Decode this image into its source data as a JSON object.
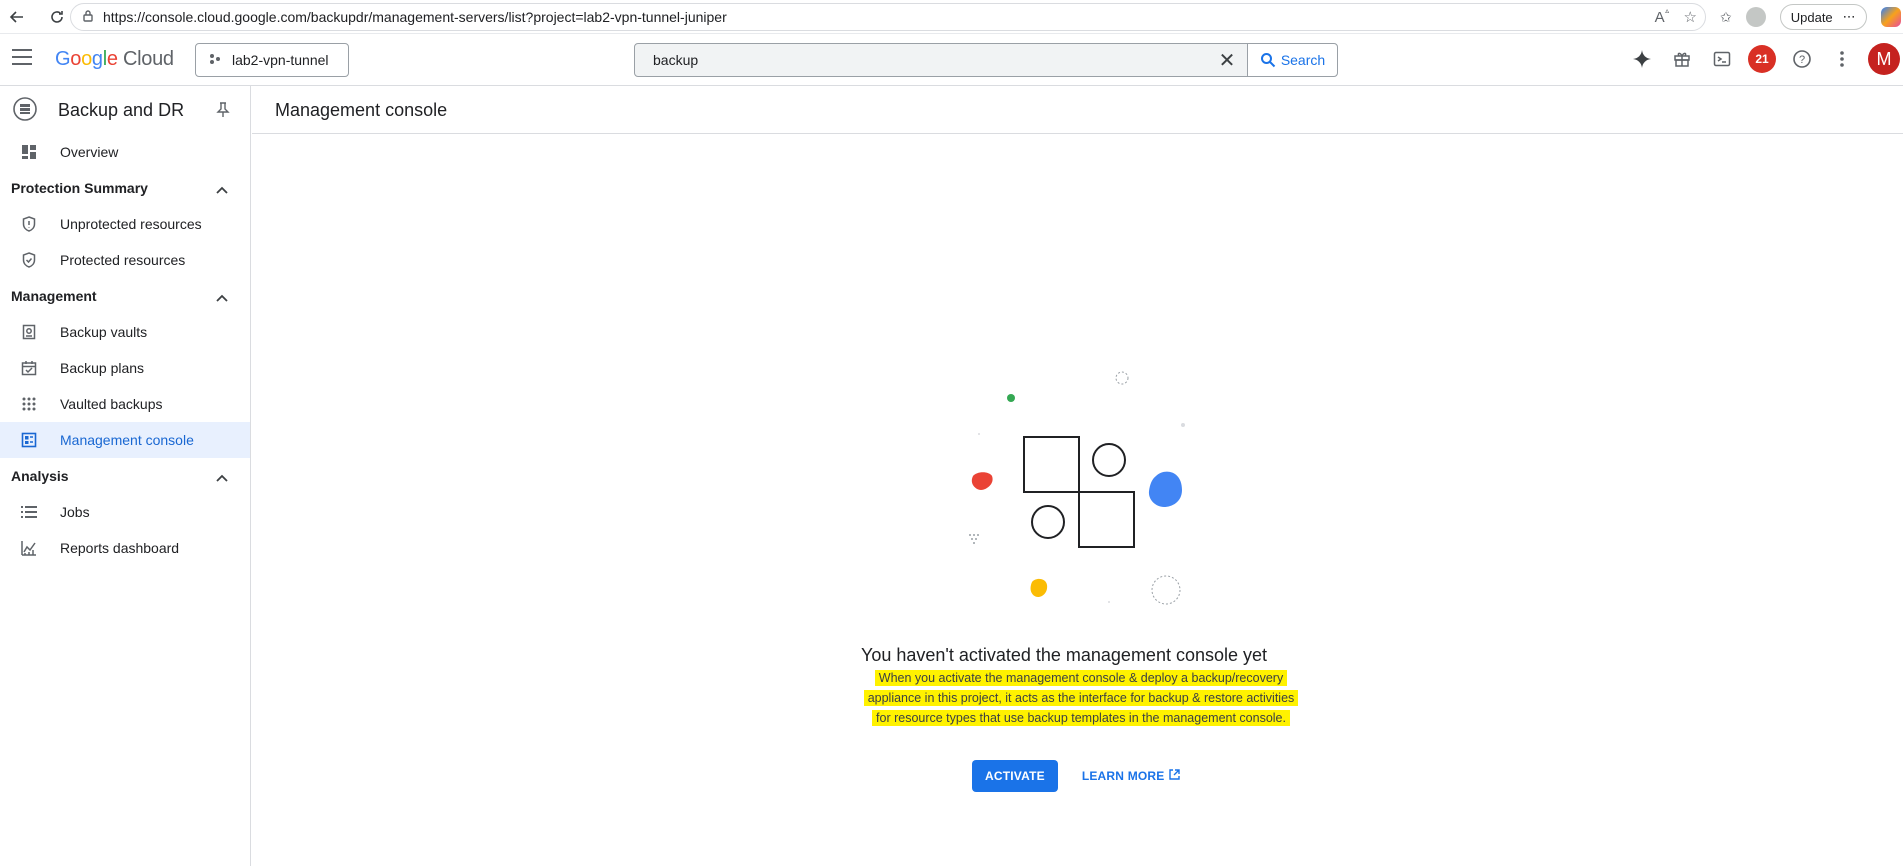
{
  "browser": {
    "url": "https://console.cloud.google.com/backupdr/management-servers/list?project=lab2-vpn-tunnel-juniper",
    "update_label": "Update"
  },
  "header": {
    "logo_google": "Google",
    "logo_cloud": "Cloud",
    "project": "lab2-vpn-tunnel",
    "search_value": "backup",
    "search_button": "Search",
    "notification_count": "21",
    "avatar_initial": "M"
  },
  "sidebar": {
    "title": "Backup and DR",
    "overview": "Overview",
    "sections": [
      {
        "label": "Protection Summary",
        "items": [
          "Unprotected resources",
          "Protected resources"
        ]
      },
      {
        "label": "Management",
        "items": [
          "Backup vaults",
          "Backup plans",
          "Vaulted backups",
          "Management console"
        ]
      },
      {
        "label": "Analysis",
        "items": [
          "Jobs",
          "Reports dashboard"
        ]
      }
    ],
    "active_item": "Management console"
  },
  "main": {
    "page_title": "Management console",
    "empty_title": "You haven't activated the management console yet",
    "empty_desc_1": "When you activate the management console & deploy a backup/recovery",
    "empty_desc_2": "appliance in this project, it acts as the interface for backup & restore activities",
    "empty_desc_3": "for resource types that use backup templates in the management console.",
    "activate_label": "ACTIVATE",
    "learn_more_label": "LEARN MORE"
  },
  "colors": {
    "accent": "#1a73e8",
    "highlight": "#fff200",
    "active_bg": "#e8f0fe"
  }
}
